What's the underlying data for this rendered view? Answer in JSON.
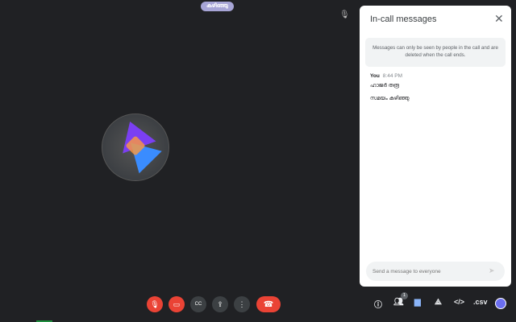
{
  "top_badge": "കഴിഞ്ഞു",
  "panel": {
    "title": "In-call messages",
    "notice": "Messages can only be seen by people in the call and are deleted when the call ends.",
    "messages": [
      {
        "sender": "You",
        "time": "8:44 PM",
        "lines": [
          "ഹാജർ തരൂ",
          "സമയം കഴിഞ്ഞു"
        ]
      }
    ],
    "input_placeholder": "Send a message to everyone"
  },
  "toolbar": {
    "participant_count": "1",
    "csv_label": ".csv",
    "code_label": "</>"
  }
}
